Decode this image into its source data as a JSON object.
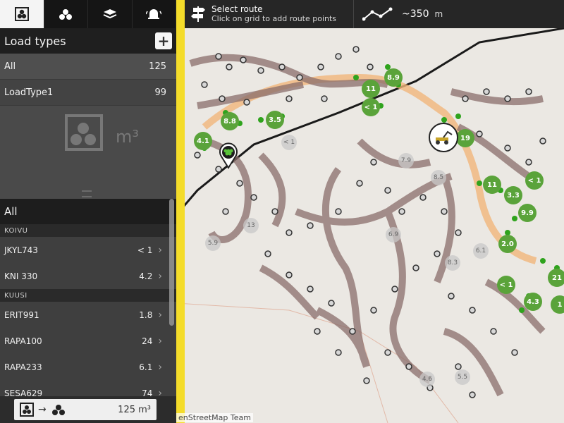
{
  "sidebar": {
    "panel_title": "Load types",
    "add_label": "+",
    "load_types": [
      {
        "name": "All",
        "value": "125"
      },
      {
        "name": "LoadType1",
        "value": "99"
      }
    ],
    "filler_unit": "m³",
    "section_title": "All",
    "groups": [
      {
        "name": "KOIVU",
        "items": [
          {
            "name": "JKYL743",
            "value": "< 1"
          },
          {
            "name": "KNI 330",
            "value": "4.2"
          }
        ]
      },
      {
        "name": "KUUSI",
        "items": [
          {
            "name": "ERIT991",
            "value": "1.8"
          },
          {
            "name": "RAPA100",
            "value": "24"
          },
          {
            "name": "RAPA233",
            "value": "6.1"
          },
          {
            "name": "SESA629",
            "value": "74"
          }
        ]
      }
    ],
    "bottom_button": {
      "arrow": "→",
      "volume": "125 m³"
    }
  },
  "topbar": {
    "title": "Select route",
    "subtitle": "Click on grid to add route points",
    "distance": "~350",
    "unit": "m"
  },
  "map": {
    "attribution": "enStreetMap Team",
    "markers_green": [
      {
        "label": "8.9"
      },
      {
        "label": "11"
      },
      {
        "label": "< 1"
      },
      {
        "label": "8.8"
      },
      {
        "label": "3.5"
      },
      {
        "label": "4.1"
      },
      {
        "label": "19"
      },
      {
        "label": "11"
      },
      {
        "label": "< 1"
      },
      {
        "label": "3.3"
      },
      {
        "label": "9.9"
      },
      {
        "label": "2.0"
      },
      {
        "label": "< 1"
      },
      {
        "label": "21"
      },
      {
        "label": "4.3"
      },
      {
        "label": "1"
      }
    ],
    "markers_gray": [
      {
        "label": "< 1"
      },
      {
        "label": "7.9"
      },
      {
        "label": "8.5"
      },
      {
        "label": "13"
      },
      {
        "label": "6.9"
      },
      {
        "label": "6.1"
      },
      {
        "label": "8.3"
      },
      {
        "label": "5.9"
      },
      {
        "label": "4.6"
      },
      {
        "label": "5.5"
      }
    ]
  },
  "colors": {
    "accent_green": "#5aa33a",
    "trail": "#8a6e6b",
    "route_orange": "#f1b57a",
    "road_yellow": "#f4dc2a"
  }
}
